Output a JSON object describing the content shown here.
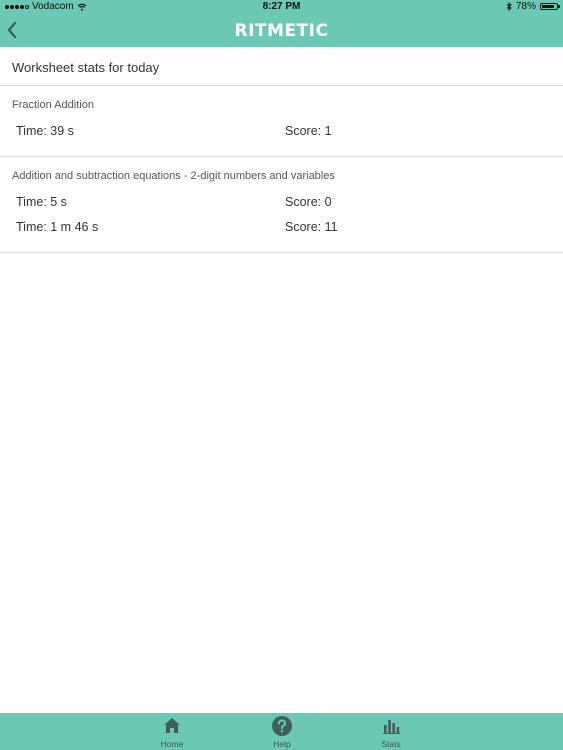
{
  "status_bar": {
    "carrier": "Vodacom",
    "time": "8:27 PM",
    "battery": "78%"
  },
  "nav": {
    "title": "RITMETIC"
  },
  "page": {
    "heading": "Worksheet stats for today"
  },
  "worksheets": [
    {
      "title": "Fraction Addition",
      "rows": [
        {
          "time": "Time: 39 s",
          "score": "Score: 1"
        }
      ]
    },
    {
      "title": "Addition and subtraction equations - 2-digit numbers and variables",
      "rows": [
        {
          "time": "Time: 5 s",
          "score": "Score: 0"
        },
        {
          "time": "Time: 1 m 46 s",
          "score": "Score: 11"
        }
      ]
    }
  ],
  "tabs": [
    {
      "label": "Home",
      "icon": "home-icon"
    },
    {
      "label": "Help",
      "icon": "help-icon"
    },
    {
      "label": "Stats",
      "icon": "stats-icon"
    }
  ],
  "colors": {
    "accent": "#6bc8b4",
    "divider": "#dcdcdc"
  }
}
